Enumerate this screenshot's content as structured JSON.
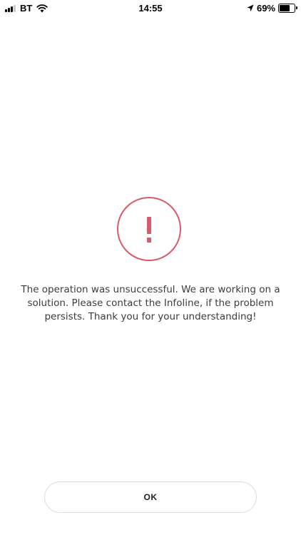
{
  "status_bar": {
    "carrier": "BT",
    "time": "14:55",
    "battery_percent": "69%",
    "battery_level": 0.69,
    "icons": [
      "signal-icon",
      "wifi-icon",
      "location-arrow-icon",
      "battery-icon"
    ]
  },
  "error": {
    "icon": "exclamation-circle-icon",
    "accent_color": "#d65b6b",
    "message": "The operation was unsuccessful. We are working on a solution. Please contact the Infoline, if the problem persists. Thank you for your understanding!"
  },
  "actions": {
    "ok_label": "OK"
  }
}
